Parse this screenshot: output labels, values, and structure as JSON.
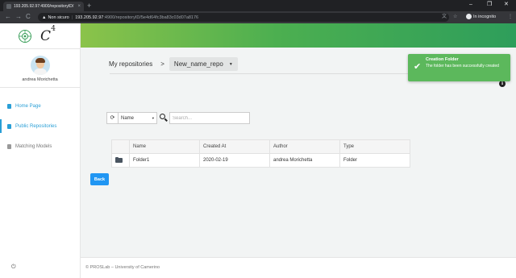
{
  "browser": {
    "tab_title": "193.205.92.97:4900/repositoryID/",
    "tab_close": "×",
    "new_tab": "+",
    "window_controls": {
      "minimize": "–",
      "maximize": "❐",
      "close": "✕"
    },
    "nav": {
      "back": "←",
      "forward": "→",
      "reload": "C"
    },
    "security_icon": "▲",
    "security_label": "Non sicuro",
    "url_separator": "|",
    "url_host": "193.205.92.97",
    "url_path": ":4900/repositoryID/5e4d64fc3ba83c03d07a8176",
    "incognito_label": "In incognito",
    "icons": [
      "translate-icon",
      "star-icon",
      "incognito-icon",
      "menu-dots-icon"
    ]
  },
  "app": {
    "brand": {
      "letter": "C",
      "sup": "4"
    },
    "user": {
      "name": "andrea Morichetta"
    },
    "sidebar": {
      "items": [
        {
          "label": "Home Page",
          "style": "blue",
          "active": false
        },
        {
          "label": "Public Repositories",
          "style": "blue",
          "active": true
        },
        {
          "label": "Matching Models",
          "style": "grey",
          "active": false
        }
      ],
      "logout_icon": "⏻"
    },
    "breadcrumb": {
      "root": "My repositories",
      "separator": ">",
      "current": "New_name_repo",
      "caret": "▼"
    },
    "info_glyph": "i",
    "filters": {
      "refresh_glyph": "⟳",
      "field_selected": "Name",
      "field_caret": "▾",
      "search_placeholder": "Search..."
    },
    "table": {
      "headers": [
        "",
        "Name",
        "Created At",
        "Author",
        "Type"
      ],
      "rows": [
        {
          "icon": "folder-icon",
          "name": "Folder1",
          "created_at": "2020-02-19",
          "author": "andrea Morichetta",
          "type": "Folder"
        }
      ]
    },
    "back_label": "Back",
    "footer": "© PROSLab – University of Camerino",
    "toast": {
      "title": "Creation Folder",
      "message": "The folder has been successfully created",
      "check_glyph": "✔"
    }
  },
  "colors": {
    "accent": "#2a9fd6",
    "band_start": "#8bc34a",
    "band_end": "#2e9e5b",
    "toast": "#5cb85c",
    "button": "#2196f3"
  }
}
